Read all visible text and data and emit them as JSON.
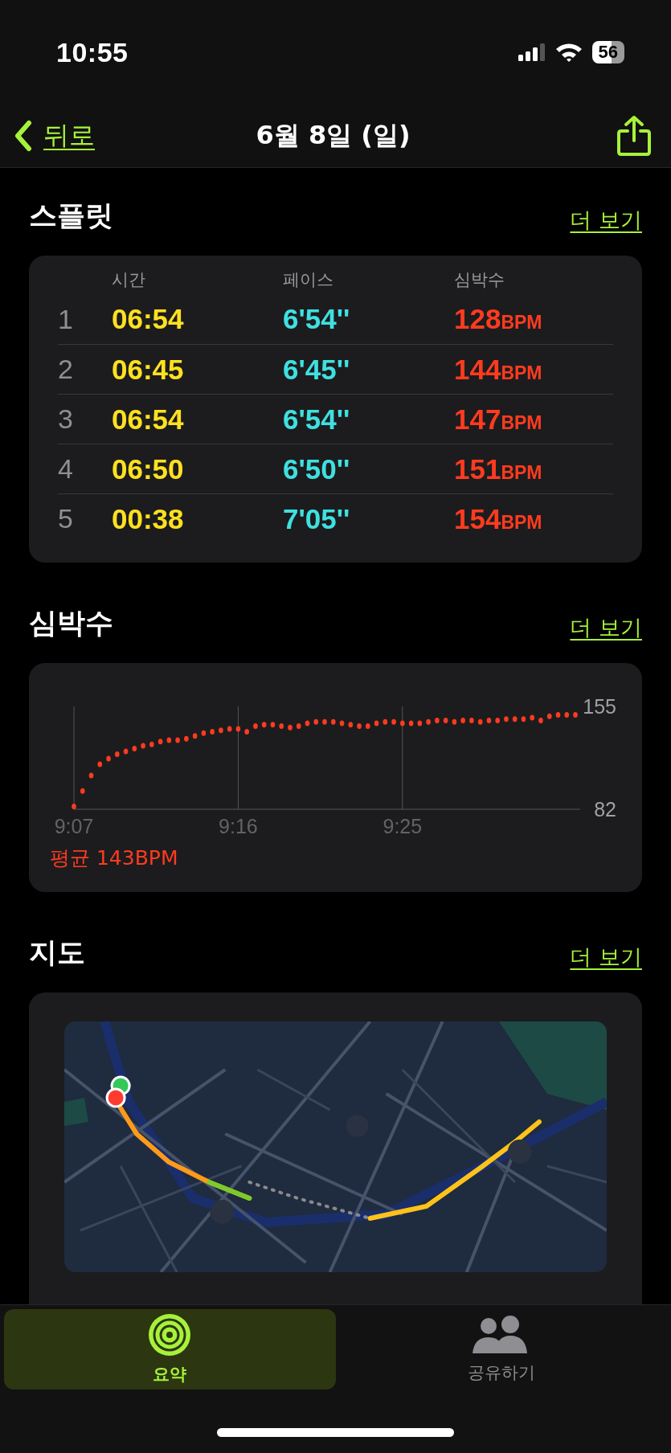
{
  "status_bar": {
    "time": "10:55",
    "battery": "56"
  },
  "nav": {
    "back": "뒤로",
    "title": "6월 8일 (일)"
  },
  "splits": {
    "title": "스플릿",
    "more": "더 보기",
    "columns": [
      "시간",
      "페이스",
      "심박수"
    ],
    "rows": [
      {
        "index": "1",
        "time": "06:54",
        "pace": "6'54''",
        "bpm": "128",
        "unit": "BPM"
      },
      {
        "index": "2",
        "time": "06:45",
        "pace": "6'45''",
        "bpm": "144",
        "unit": "BPM"
      },
      {
        "index": "3",
        "time": "06:54",
        "pace": "6'54''",
        "bpm": "147",
        "unit": "BPM"
      },
      {
        "index": "4",
        "time": "06:50",
        "pace": "6'50''",
        "bpm": "151",
        "unit": "BPM"
      },
      {
        "index": "5",
        "time": "00:38",
        "pace": "7'05''",
        "bpm": "154",
        "unit": "BPM"
      }
    ]
  },
  "heart_rate": {
    "title": "심박수",
    "more": "더 보기",
    "average": "평균 143BPM",
    "chart_data": {
      "type": "scatter",
      "categories": [
        "9:07",
        null,
        null,
        null,
        null,
        null,
        null,
        null,
        null,
        null,
        null,
        null,
        null,
        null,
        null,
        null,
        null,
        null,
        null,
        "9:16",
        null,
        null,
        null,
        null,
        null,
        null,
        null,
        null,
        null,
        null,
        null,
        null,
        null,
        null,
        null,
        null,
        null,
        null,
        "9:25",
        null,
        null,
        null,
        null,
        null,
        null,
        null,
        null,
        null,
        null,
        null,
        null,
        null,
        null,
        null,
        null,
        null,
        null,
        null,
        null
      ],
      "series": [
        {
          "color": "#ff3b1f",
          "values": [
            84,
            95,
            106,
            114,
            118,
            121,
            123,
            125,
            127,
            128,
            130,
            131,
            131,
            132,
            134,
            136,
            137,
            138,
            139,
            139,
            137,
            141,
            142,
            142,
            141,
            140,
            141,
            143,
            144,
            144,
            144,
            143,
            142,
            141,
            141,
            143,
            144,
            144,
            143,
            143,
            143,
            144,
            145,
            145,
            144,
            145,
            145,
            144,
            145,
            145,
            146,
            146,
            146,
            147,
            145,
            148,
            149,
            149,
            149
          ]
        }
      ],
      "ylim": [
        82,
        155
      ],
      "yticks": [
        {
          "value": 155,
          "label": "155"
        },
        {
          "value": 82,
          "label": "82"
        }
      ]
    }
  },
  "map": {
    "title": "지도",
    "more": "더 보기",
    "kind": "picture"
  },
  "tabs": [
    {
      "label": "요약",
      "selected": true
    },
    {
      "label": "공유하기",
      "selected": false
    }
  ]
}
